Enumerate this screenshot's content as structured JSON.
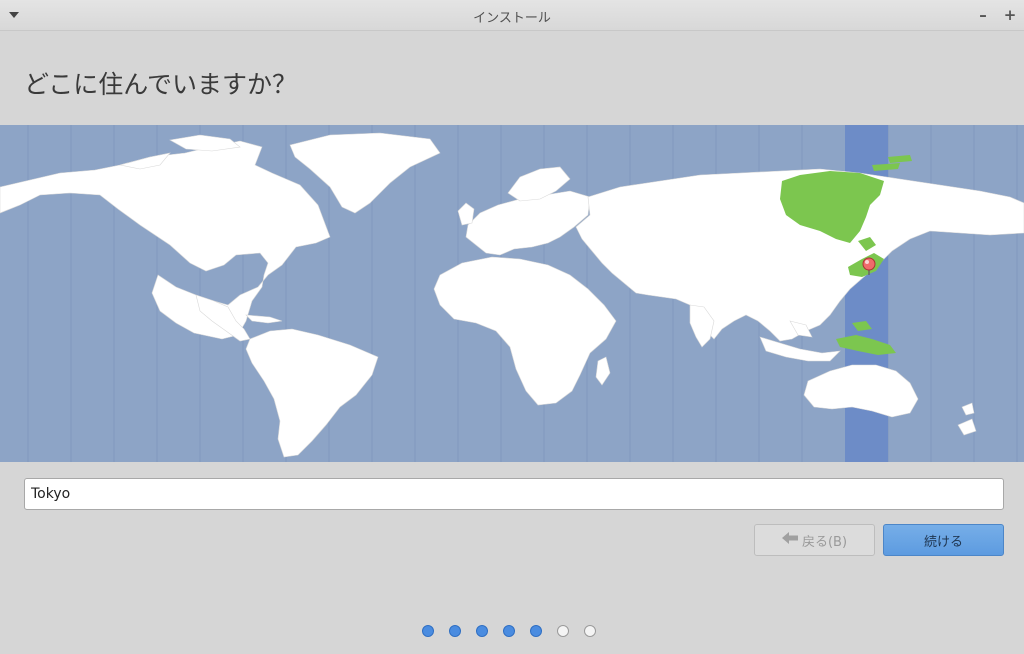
{
  "window": {
    "title": "インストール",
    "minimize_label": "–",
    "maximize_label": "+"
  },
  "page": {
    "title": "どこに住んでいますか？"
  },
  "map": {
    "selected_city": "Tokyo",
    "highlight_color": "#7cc64f",
    "band_color": "#6d8cc7",
    "ocean_color": "#8da4c6",
    "land_color": "#ffffff"
  },
  "timezone": {
    "value": "Tokyo"
  },
  "buttons": {
    "back_label": "戻る(B)",
    "continue_label": "続ける"
  },
  "progress": {
    "steps_total": 7,
    "steps_completed": 5
  }
}
